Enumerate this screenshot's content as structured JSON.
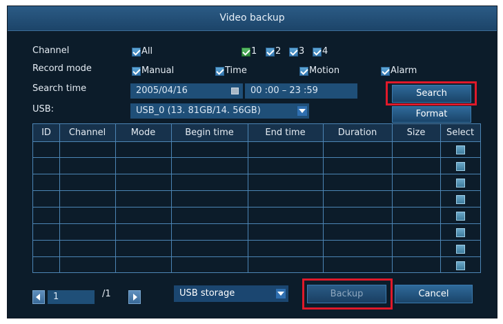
{
  "window": {
    "title": "Video backup"
  },
  "channel": {
    "label": "Channel",
    "all_label": "All",
    "ch": [
      "1",
      "2",
      "3",
      "4"
    ]
  },
  "record_mode": {
    "label": "Record mode",
    "options": [
      "Manual",
      "Time",
      "Motion",
      "Alarm"
    ]
  },
  "search_time": {
    "label": "Search time",
    "date": "2005/04/16",
    "time_range": "00 :00  –  23 :59"
  },
  "usb": {
    "label": "USB:",
    "device": "USB_0  (13. 81GB/14. 56GB)"
  },
  "buttons": {
    "search": "Search",
    "format": "Format",
    "backup": "Backup",
    "cancel": "Cancel"
  },
  "table": {
    "columns": [
      "ID",
      "Channel",
      "Mode",
      "Begin time",
      "End time",
      "Duration",
      "Size",
      "Select"
    ],
    "row_count": 8
  },
  "pager": {
    "page": "1",
    "total": "/1"
  },
  "storage": {
    "selected": "USB storage"
  },
  "colors": {
    "accent": "#2f6a9a",
    "highlight": "#e0192a"
  }
}
